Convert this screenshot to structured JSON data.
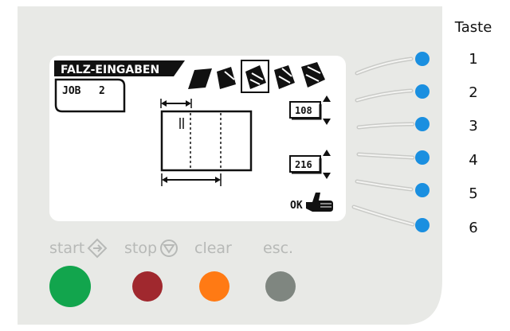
{
  "side": {
    "header": "Taste",
    "numbers": [
      "1",
      "2",
      "3",
      "4",
      "5",
      "6"
    ]
  },
  "display": {
    "title": "FALZ-EINGABEN",
    "job_label": "JOB",
    "job_number": "2",
    "value_upper": "108",
    "value_lower": "216",
    "ok_label": "OK"
  },
  "controls": {
    "start": "start",
    "stop": "stop",
    "clear": "clear",
    "esc": "esc."
  },
  "colors": {
    "panel": "#e8e9e6",
    "screen": "#ffffff",
    "soft_key": "#1a8fe0",
    "start": "#12a54d",
    "stop": "#a0282e",
    "clear": "#ff7a14",
    "esc": "#7f8680"
  },
  "icons": {
    "soft_keys": "blue-dot-icon",
    "ok": "pointing-hand-icon",
    "start": "start-diamond-icon",
    "stop": "stop-circle-icon"
  }
}
